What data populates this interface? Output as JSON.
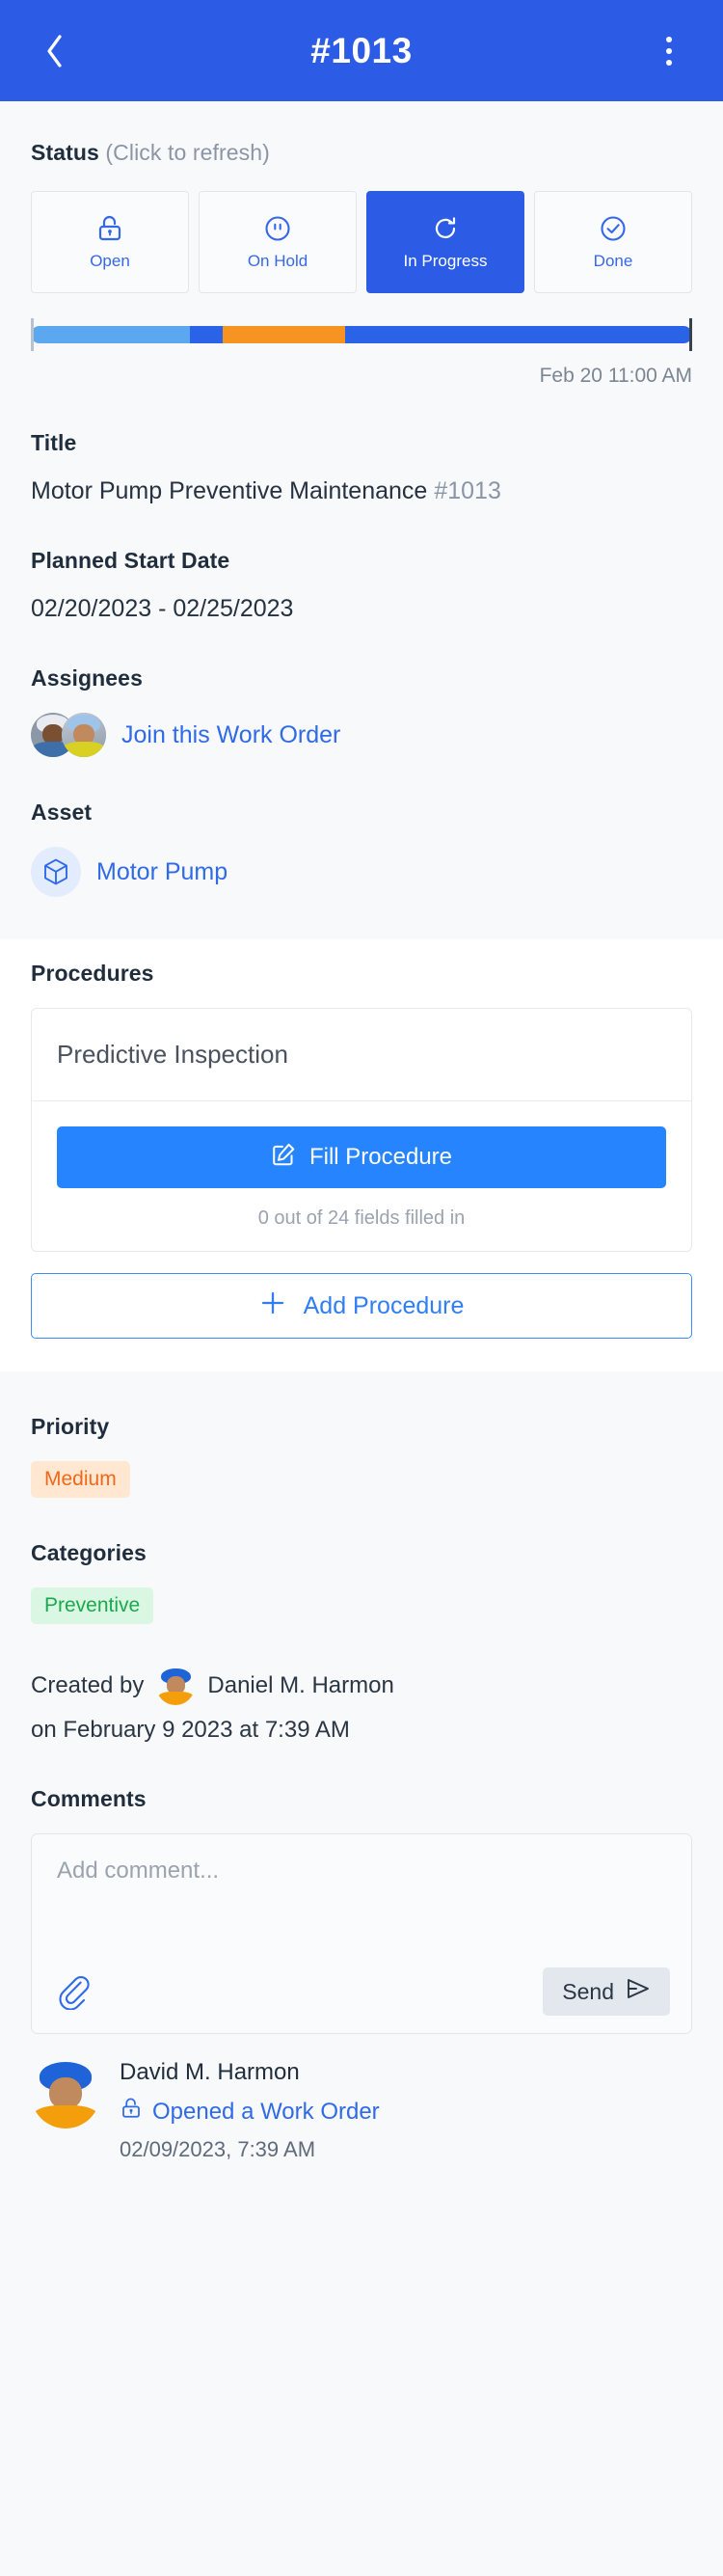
{
  "appbar": {
    "back_icon": "chevron-left-icon",
    "title": "#1013",
    "menu_icon": "overflow-menu-icon"
  },
  "status": {
    "label": "Status",
    "hint": "(Click to refresh)",
    "buttons": [
      {
        "label": "Open",
        "icon": "unlock-icon",
        "active": false
      },
      {
        "label": "On Hold",
        "icon": "pause-circle-icon",
        "active": false
      },
      {
        "label": "In Progress",
        "icon": "refresh-icon",
        "active": true
      },
      {
        "label": "Done",
        "icon": "check-circle-icon",
        "active": false
      }
    ],
    "progress_segments": [
      {
        "color": "#5ba8f0",
        "width": 24.0
      },
      {
        "color": "#2b63e8",
        "width": 5.0
      },
      {
        "color": "#f79421",
        "width": 18.5
      },
      {
        "color": "#2b63e8",
        "width": 52.5
      }
    ],
    "timestamp": "Feb 20 11:00 AM"
  },
  "title_block": {
    "label": "Title",
    "value": "Motor Pump Preventive Maintenance",
    "id": "#1013"
  },
  "planned_start": {
    "label": "Planned Start Date",
    "value": "02/20/2023 - 02/25/2023"
  },
  "assignees": {
    "label": "Assignees",
    "join_label": "Join this Work Order",
    "avatar_count": 2
  },
  "asset": {
    "label": "Asset",
    "icon": "cube-icon",
    "name": "Motor Pump"
  },
  "procedures": {
    "label": "Procedures",
    "cards": [
      {
        "title": "Predictive Inspection",
        "fill_label": "Fill Procedure",
        "fill_icon": "edit-square-icon",
        "fields_note": "0 out of 24 fields filled in"
      }
    ],
    "add_label": "Add Procedure",
    "add_icon": "plus-icon"
  },
  "priority": {
    "label": "Priority",
    "value": "Medium",
    "bg": "#ffe7d1",
    "fg": "#f2671a"
  },
  "categories": {
    "label": "Categories",
    "values": [
      "Preventive"
    ],
    "bg": "#d9f7e2",
    "fg": "#1ba94c"
  },
  "created": {
    "prefix": "Created by",
    "author": "Daniel M. Harmon",
    "when": "on February 9 2023 at 7:39 AM"
  },
  "comments": {
    "label": "Comments",
    "placeholder": "Add comment...",
    "attach_icon": "paperclip-icon",
    "send_label": "Send",
    "send_icon": "send-icon"
  },
  "activity": [
    {
      "name": "David M. Harmon",
      "action": "Opened a Work Order",
      "action_icon": "unlock-icon",
      "time": "02/09/2023, 7:39 AM"
    }
  ],
  "colors": {
    "brand": "#2c5ce6",
    "link": "#2f6ae8",
    "primary_button": "#2684ff"
  }
}
